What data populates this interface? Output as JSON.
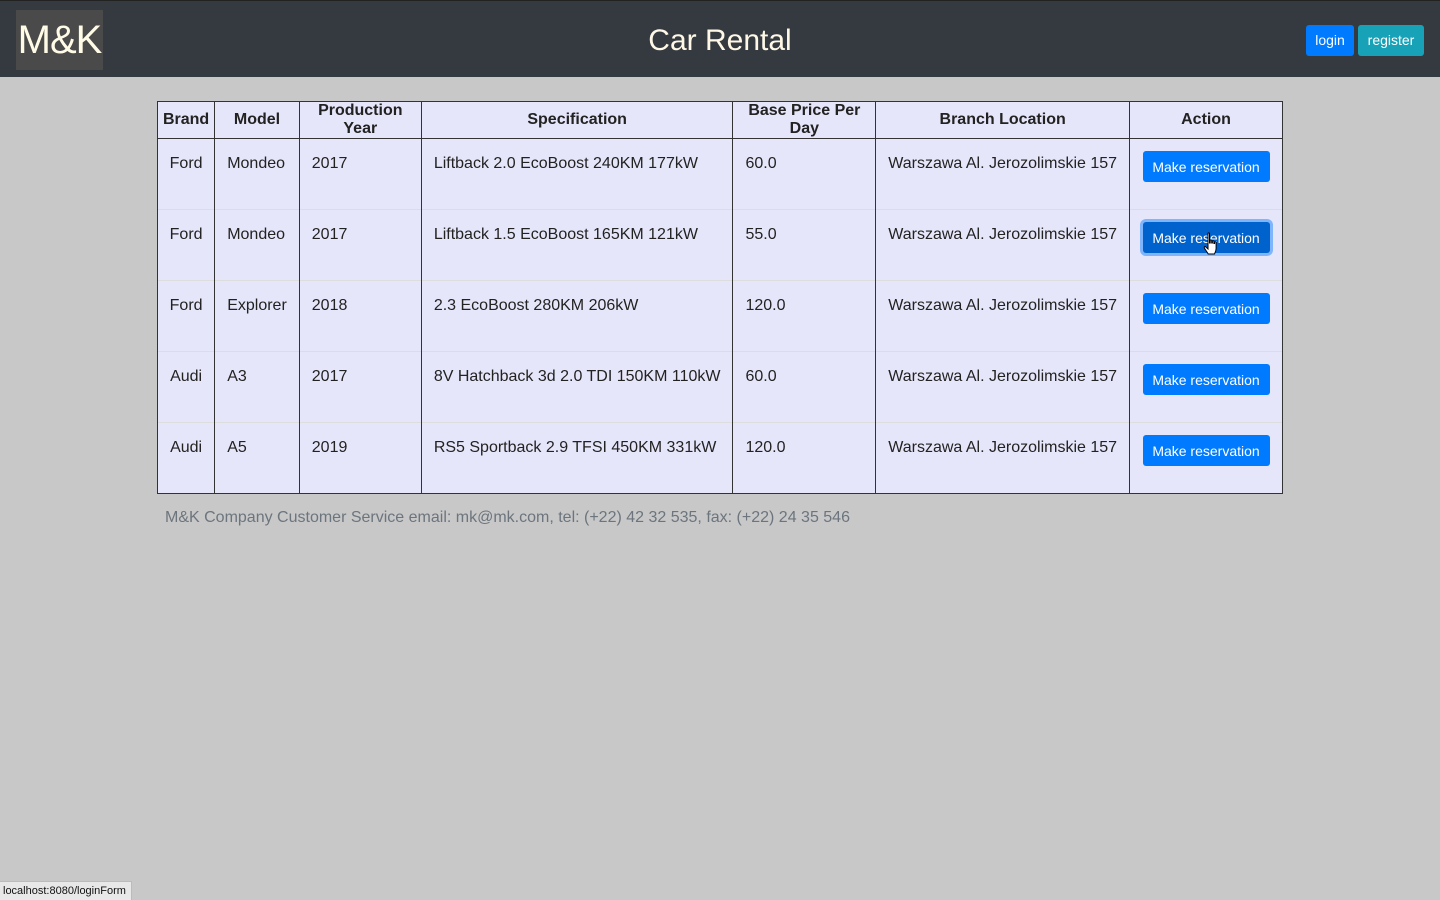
{
  "header": {
    "logo": "M&K",
    "title": "Car Rental",
    "login_label": "login",
    "register_label": "register"
  },
  "table": {
    "columns": [
      "Brand",
      "Model",
      "Production Year",
      "Specification",
      "Base Price Per Day",
      "Branch Location",
      "Action"
    ],
    "rows": [
      {
        "brand": "Ford",
        "model": "Mondeo",
        "year": "2017",
        "spec": "Liftback 2.0 EcoBoost 240KM 177kW",
        "price": "60.0",
        "location": "Warszawa Al. Jerozolimskie 157",
        "action": "Make reservation"
      },
      {
        "brand": "Ford",
        "model": "Mondeo",
        "year": "2017",
        "spec": "Liftback 1.5 EcoBoost 165KM 121kW",
        "price": "55.0",
        "location": "Warszawa Al. Jerozolimskie 157",
        "action": "Make reservation"
      },
      {
        "brand": "Ford",
        "model": "Explorer",
        "year": "2018",
        "spec": "2.3 EcoBoost 280KM 206kW",
        "price": "120.0",
        "location": "Warszawa Al. Jerozolimskie 157",
        "action": "Make reservation"
      },
      {
        "brand": "Audi",
        "model": "A3",
        "year": "2017",
        "spec": "8V Hatchback 3d 2.0 TDI 150KM 110kW",
        "price": "60.0",
        "location": "Warszawa Al. Jerozolimskie 157",
        "action": "Make reservation"
      },
      {
        "brand": "Audi",
        "model": "A5",
        "year": "2019",
        "spec": "RS5 Sportback 2.9 TFSI 450KM 331kW",
        "price": "120.0",
        "location": "Warszawa Al. Jerozolimskie 157",
        "action": "Make reservation"
      }
    ]
  },
  "footer": {
    "text": "M&K Company Customer Service email: mk@mk.com, tel: (+22) 42 32 535, fax: (+22) 24 35 546"
  },
  "status_bar": {
    "url": "localhost:8080/loginForm"
  },
  "colors": {
    "header_bg": "#343a40",
    "page_bg": "#c8c8c8",
    "table_bg": "#e6e6fa",
    "primary": "#007bff",
    "info": "#17a2b8"
  },
  "icons": {
    "cursor": "hand-pointer-icon"
  }
}
